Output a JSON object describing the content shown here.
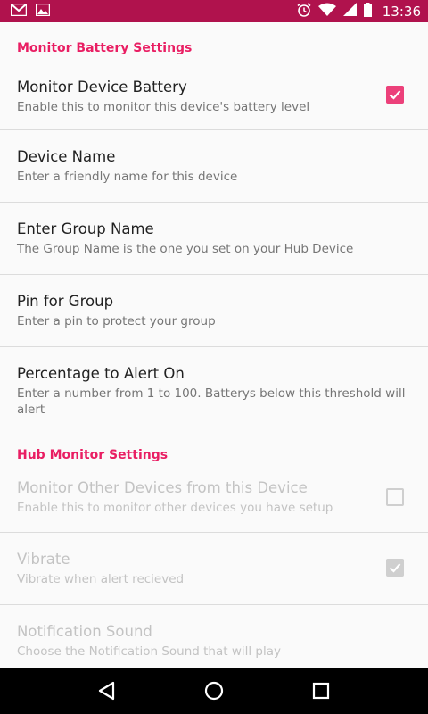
{
  "status_bar": {
    "time": "13:36",
    "left_icons": [
      "gmail-icon",
      "image-icon"
    ],
    "right_icons": [
      "alarm-icon",
      "wifi-icon",
      "signal-icon",
      "battery-icon"
    ]
  },
  "sections": {
    "battery": {
      "title": "Monitor Battery Settings",
      "items": [
        {
          "title": "Monitor Device Battery",
          "summary": "Enable this to monitor this device's battery level",
          "checked": true
        },
        {
          "title": "Device Name",
          "summary": "Enter a friendly name for this device"
        },
        {
          "title": "Enter Group Name",
          "summary": "The Group Name is the one you set on your Hub Device"
        },
        {
          "title": "Pin for Group",
          "summary": "Enter a pin to protect your group"
        },
        {
          "title": "Percentage to Alert On",
          "summary": "Enter a number from 1 to 100. Batterys below this threshold will alert"
        }
      ]
    },
    "hub": {
      "title": "Hub Monitor Settings",
      "items": [
        {
          "title": "Monitor Other Devices from this Device",
          "summary": "Enable this to monitor other devices you have setup",
          "checked": false
        },
        {
          "title": "Vibrate",
          "summary": "Vibrate when alert recieved",
          "checked": true
        },
        {
          "title": "Notification Sound",
          "summary": "Choose the Notification Sound that will play"
        }
      ]
    }
  },
  "nav_bar": {
    "icons": [
      "back-icon",
      "home-icon",
      "recents-icon"
    ]
  },
  "colors": {
    "status_bar": "#b0124d",
    "accent": "#e91e63",
    "checkbox": "#ec407a",
    "disabled_text": "#c3c3c3"
  }
}
